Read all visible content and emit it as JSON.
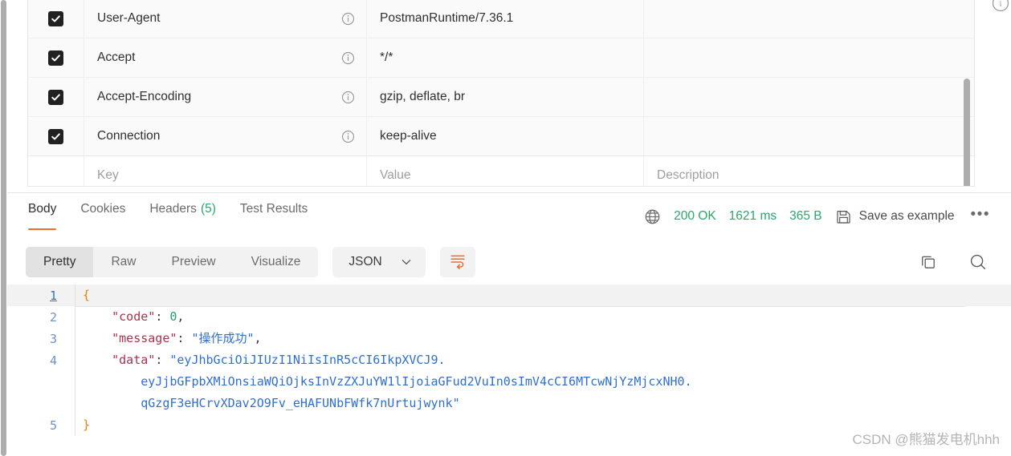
{
  "headers_table": {
    "columns": [
      "Key",
      "Value",
      "Description"
    ],
    "placeholder_row": {
      "key": "Key",
      "value": "Value",
      "description": "Description"
    },
    "rows": [
      {
        "checked": true,
        "key": "User-Agent",
        "value": "PostmanRuntime/7.36.1",
        "description": ""
      },
      {
        "checked": true,
        "key": "Accept",
        "value": "*/*",
        "description": ""
      },
      {
        "checked": true,
        "key": "Accept-Encoding",
        "value": "gzip, deflate, br",
        "description": ""
      },
      {
        "checked": true,
        "key": "Connection",
        "value": "keep-alive",
        "description": ""
      }
    ]
  },
  "response": {
    "tabs": [
      {
        "label": "Body",
        "count": "",
        "active": true
      },
      {
        "label": "Cookies",
        "count": "",
        "active": false
      },
      {
        "label": "Headers",
        "count": "(5)",
        "active": false
      },
      {
        "label": "Test Results",
        "count": "",
        "active": false
      }
    ],
    "meta": {
      "network_icon": "globe-icon",
      "status": "200 OK",
      "time": "1621 ms",
      "size": "365 B",
      "save_icon": "floppy-disk-icon",
      "save_label": "Save as example",
      "more_label": "•••"
    },
    "format": {
      "views": [
        {
          "label": "Pretty",
          "active": true
        },
        {
          "label": "Raw",
          "active": false
        },
        {
          "label": "Preview",
          "active": false
        },
        {
          "label": "Visualize",
          "active": false
        }
      ],
      "language": "JSON",
      "chevron": "chevron-down-icon",
      "wrap_icon": "word-wrap-icon",
      "copy_icon": "copy-icon",
      "search_icon": "search-icon"
    },
    "body": {
      "lines": [
        {
          "n": "1",
          "segments": [
            {
              "t": "{",
              "c": "brace"
            }
          ]
        },
        {
          "n": "2",
          "segments": [
            {
              "t": "    ",
              "c": "punc"
            },
            {
              "t": "\"code\"",
              "c": "key"
            },
            {
              "t": ": ",
              "c": "punc"
            },
            {
              "t": "0",
              "c": "num"
            },
            {
              "t": ",",
              "c": "punc"
            }
          ]
        },
        {
          "n": "3",
          "segments": [
            {
              "t": "    ",
              "c": "punc"
            },
            {
              "t": "\"message\"",
              "c": "key"
            },
            {
              "t": ": ",
              "c": "punc"
            },
            {
              "t": "\"操作成功\"",
              "c": "str"
            },
            {
              "t": ",",
              "c": "punc"
            }
          ]
        },
        {
          "n": "4",
          "segments": [
            {
              "t": "    ",
              "c": "punc"
            },
            {
              "t": "\"data\"",
              "c": "key"
            },
            {
              "t": ": ",
              "c": "punc"
            },
            {
              "t": "\"eyJhbGciOiJIUzI1NiIsInR5cCI6IkpXVCJ9.",
              "c": "str"
            }
          ]
        },
        {
          "n": "",
          "segments": [
            {
              "t": "        eyJjbGFpbXMiOnsiaWQiOjksInVzZXJuYW1lIjoiaGFud2VuIn0sImV4cCI6MTcwNjYzMjcxNH0.",
              "c": "str"
            }
          ]
        },
        {
          "n": "",
          "segments": [
            {
              "t": "        qGzgF3eHCrvXDav2O9Fv_eHAFUNbFWfk7nUrtujwynk\"",
              "c": "str"
            }
          ]
        },
        {
          "n": "5",
          "segments": [
            {
              "t": "}",
              "c": "brace"
            }
          ]
        }
      ]
    }
  },
  "watermark": "CSDN @熊猫发电机hhh",
  "colors": {
    "accent_orange": "#ef6c2f",
    "status_green": "#2aa86a",
    "json_key": "#a8334c",
    "json_string": "#2f6fd0",
    "json_number": "#1f9c6e",
    "json_brace": "#e8820c"
  }
}
